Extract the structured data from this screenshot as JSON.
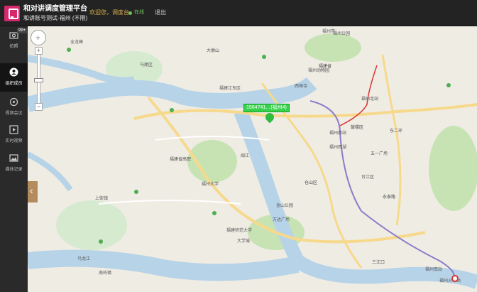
{
  "header": {
    "title": "和对讲调度管理平台",
    "subtitle": "和讲账号测试·福州 (不限)",
    "welcome": "欢迎您，调度台",
    "status": "在线",
    "logout": "退出"
  },
  "sidebar": {
    "items": [
      {
        "label": "拍照",
        "icon": "camera-icon",
        "badge": "99+"
      },
      {
        "label": "组织成员",
        "icon": "contacts-icon"
      },
      {
        "label": "视频会议",
        "icon": "video-meeting-icon"
      },
      {
        "label": "实时视频",
        "icon": "play-icon"
      },
      {
        "label": "媒体记录",
        "icon": "image-icon"
      }
    ]
  },
  "map": {
    "tracker_label": "1564741…(福州4)",
    "labels": [
      "全龙峰",
      "大墩山",
      "福州市",
      "福州公园",
      "福州北站",
      "福建省",
      "马尾区",
      "福建江东区",
      "福州动物园",
      "西禅寺",
      "福州西站",
      "福建省高职",
      "福州西湖",
      "五一广场",
      "台江区",
      "东二环",
      "鼓楼区",
      "福州大学",
      "仓山区",
      "福建师范大学",
      "永泰路",
      "闽江",
      "乌龙江",
      "三江口",
      "福州南站",
      "上街镇",
      "南屿镇",
      "大学城",
      "金山公园",
      "万达广场",
      "福州火车站"
    ],
    "colors": {
      "river": "#b7d3e8",
      "land": "#efece4",
      "green": "#c7e3b4",
      "road": "#f7d98c",
      "metro_red": "#d33",
      "metro_purple": "#8c7cc9"
    }
  }
}
